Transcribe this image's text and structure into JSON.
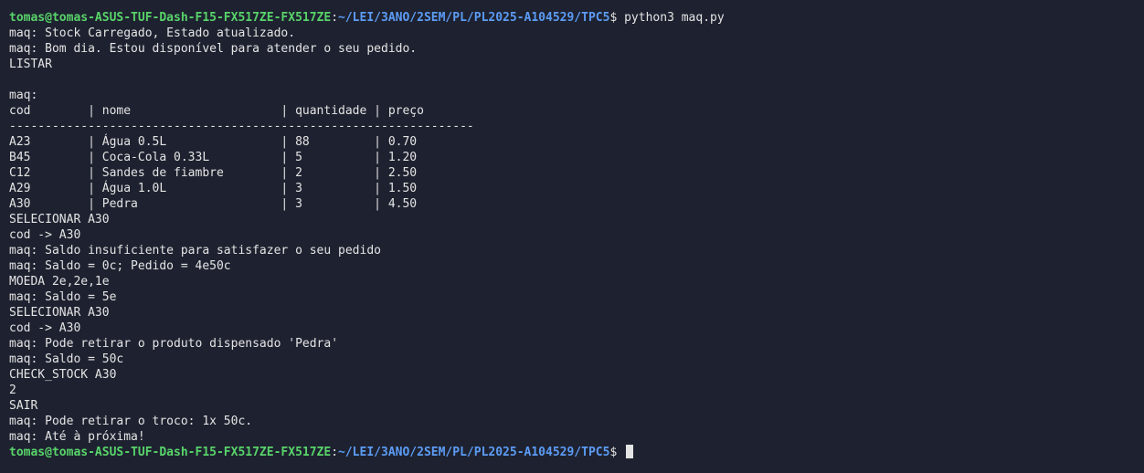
{
  "prompt": {
    "user_host": "tomas@tomas-ASUS-TUF-Dash-F15-FX517ZE-FX517ZE",
    "separator": ":",
    "path": "~/LEI/3ANO/2SEM/PL/PL2025-A104529/TPC5",
    "dollar": "$",
    "command": " python3 maq.py",
    "final_dollar": "$ "
  },
  "output": [
    "maq: Stock Carregado, Estado atualizado.",
    "maq: Bom dia. Estou disponível para atender o seu pedido.",
    "LISTAR",
    "",
    "maq:",
    "cod        | nome                     | quantidade | preço",
    "-----------------------------------------------------------------",
    "A23        | Água 0.5L                | 88         | 0.70",
    "B45        | Coca-Cola 0.33L          | 5          | 1.20",
    "C12        | Sandes de fiambre        | 2          | 2.50",
    "A29        | Água 1.0L                | 3          | 1.50",
    "A30        | Pedra                    | 3          | 4.50",
    "SELECIONAR A30",
    "cod -> A30",
    "maq: Saldo insuficiente para satisfazer o seu pedido",
    "maq: Saldo = 0c; Pedido = 4e50c",
    "MOEDA 2e,2e,1e",
    "maq: Saldo = 5e",
    "SELECIONAR A30",
    "cod -> A30",
    "maq: Pode retirar o produto dispensado 'Pedra'",
    "maq: Saldo = 50c",
    "CHECK_STOCK A30",
    "2",
    "SAIR",
    "maq: Pode retirar o troco: 1x 50c.",
    "maq: Até à próxima!"
  ]
}
